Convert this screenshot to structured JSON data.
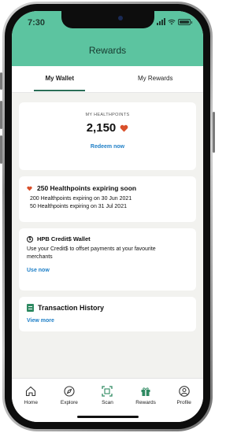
{
  "status": {
    "time": "7:30"
  },
  "header": {
    "title": "Rewards"
  },
  "tabs": [
    {
      "label": "My Wallet",
      "active": true
    },
    {
      "label": "My Rewards",
      "active": false
    }
  ],
  "healthpoints": {
    "label": "MY HEALTHPOINTS",
    "value": "2,150",
    "redeem_label": "Redeem now"
  },
  "expiring": {
    "title": "250 Healthpoints expiring soon",
    "lines": [
      "200 Healthpoints expiring on 30 Jun 2021",
      "50 Healthpoints expiring on 31 Jul 2021"
    ]
  },
  "credit_wallet": {
    "title": "HPB Credit$ Wallet",
    "description": "Use your Credit$ to offset payments at your favourite merchants",
    "link": "Use now"
  },
  "transactions": {
    "title": "Transaction History",
    "link": "View more"
  },
  "bottom_nav": [
    {
      "label": "Home",
      "icon": "home-icon"
    },
    {
      "label": "Explore",
      "icon": "compass-icon"
    },
    {
      "label": "Scan",
      "icon": "scan-icon"
    },
    {
      "label": "Rewards",
      "icon": "gift-icon"
    },
    {
      "label": "Profile",
      "icon": "profile-icon"
    }
  ],
  "colors": {
    "header": "#5cc4a0",
    "link": "#1e7fc7",
    "heart": "#d9502b",
    "accent": "#2f8a62"
  }
}
